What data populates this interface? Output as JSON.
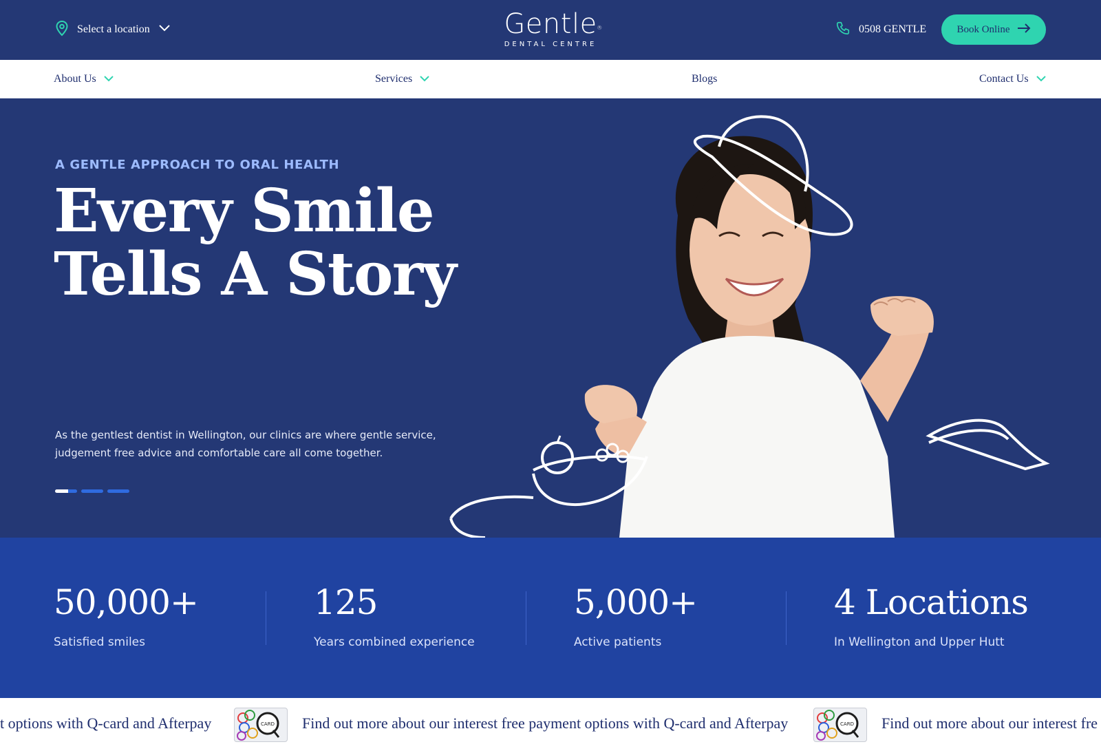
{
  "header": {
    "location_label": "Select a location",
    "logo_main": "Gentle",
    "logo_mark": "®",
    "logo_sub": "DENTAL CENTRE",
    "phone": "0508 GENTLE",
    "book_label": "Book Online"
  },
  "nav": {
    "items": [
      {
        "label": "About Us",
        "has_dropdown": true
      },
      {
        "label": "Services",
        "has_dropdown": true
      },
      {
        "label": "Blogs",
        "has_dropdown": false
      },
      {
        "label": "Contact Us",
        "has_dropdown": true
      }
    ]
  },
  "hero": {
    "eyebrow": "A GENTLE APPROACH TO ORAL HEALTH",
    "headline_line1": "Every Smile",
    "headline_line2": "Tells A Story",
    "description": "As the gentlest dentist in Wellington, our clinics are where gentle service, judgement free advice and comfortable care all come together.",
    "slides_total": 3,
    "active_slide": 1
  },
  "stats": [
    {
      "value": "50,000+",
      "label": "Satisfied smiles"
    },
    {
      "value": "125",
      "label": "Years combined experience"
    },
    {
      "value": "5,000+",
      "label": "Active patients"
    },
    {
      "value": "4 Locations",
      "label": "In Wellington and Upper Hutt"
    }
  ],
  "ticker": {
    "text_partial_left": "t options with Q-card and Afterpay",
    "text_full": "Find out more about our interest free payment options with Q-card and Afterpay",
    "text_partial_right": "Find out more about our interest fre",
    "card_label": "CARD"
  },
  "colors": {
    "navy": "#243875",
    "stats_blue": "#2043a1",
    "accent_teal": "#2fd4b0",
    "eyebrow_blue": "#9dbbff"
  },
  "icons": {
    "location": "map-pin-icon",
    "phone": "phone-icon",
    "arrow": "arrow-right-icon",
    "dropdown": "chevron-down-icon"
  }
}
